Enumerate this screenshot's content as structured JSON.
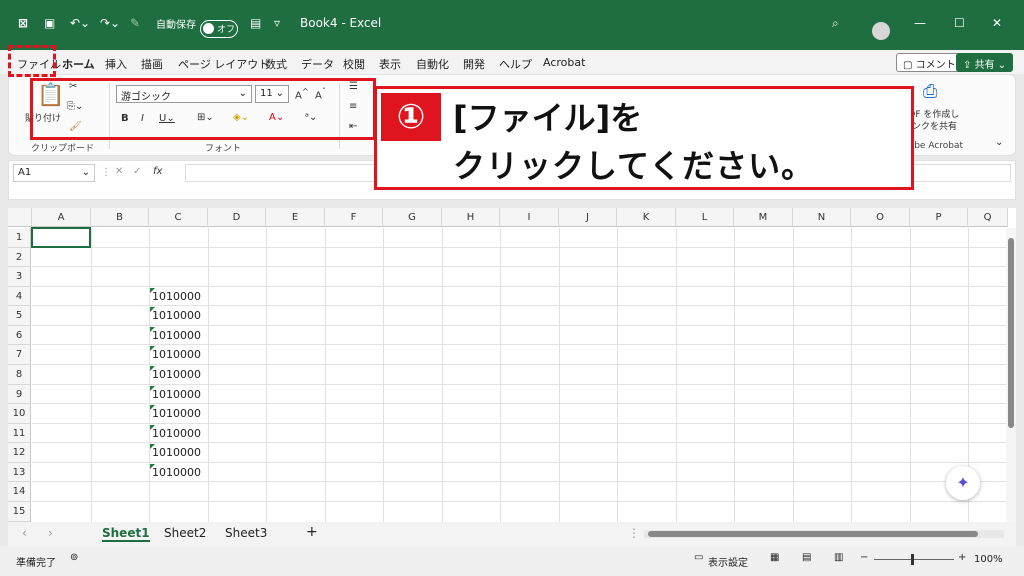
{
  "titlebar": {
    "autosave_label": "自動保存",
    "autosave_state": "オフ",
    "doc_title": "Book4 - Excel",
    "bg_color": "#1e6e41"
  },
  "tabs": [
    "ファイル",
    "ホーム",
    "挿入",
    "描画",
    "ページ レイアウト",
    "数式",
    "データ",
    "校閲",
    "表示",
    "自動化",
    "開発",
    "ヘルプ",
    "Acrobat"
  ],
  "tab_active": "ホーム",
  "comment_btn": "コメント",
  "share_btn": "共有",
  "ribbon": {
    "paste_label": "貼り付け",
    "clipboard_group": "クリップボード",
    "font_group": "フォント",
    "font_name": "游ゴシック",
    "font_size": "11",
    "acrobat_group": "Adobe Acrobat",
    "acrobat_btn_line1": "PDF を作成し",
    "acrobat_btn_line2": "リンクを共有"
  },
  "formula_bar": {
    "name_box": "A1",
    "fx": "fx"
  },
  "columns": [
    "A",
    "B",
    "C",
    "D",
    "E",
    "F",
    "G",
    "H",
    "I",
    "J",
    "K",
    "L",
    "M",
    "N",
    "O",
    "P",
    "Q"
  ],
  "rows": [
    "1",
    "2",
    "3",
    "4",
    "5",
    "6",
    "7",
    "8",
    "9",
    "10",
    "11",
    "12",
    "13",
    "14",
    "15"
  ],
  "cells_c": [
    "",
    "",
    "",
    "1010000",
    "1010000",
    "1010000",
    "1010000",
    "1010000",
    "1010000",
    "1010000",
    "1010000",
    "1010000",
    "1010000",
    "",
    ""
  ],
  "sheets": [
    "Sheet1",
    "Sheet2",
    "Sheet3"
  ],
  "active_sheet": "Sheet1",
  "status": {
    "ready": "準備完了",
    "display_settings": "表示設定",
    "zoom": "100%"
  },
  "callout": {
    "number": "①",
    "line1": "[ファイル]を",
    "line2": "クリックしてください。"
  },
  "accent_color": "#e0141e"
}
